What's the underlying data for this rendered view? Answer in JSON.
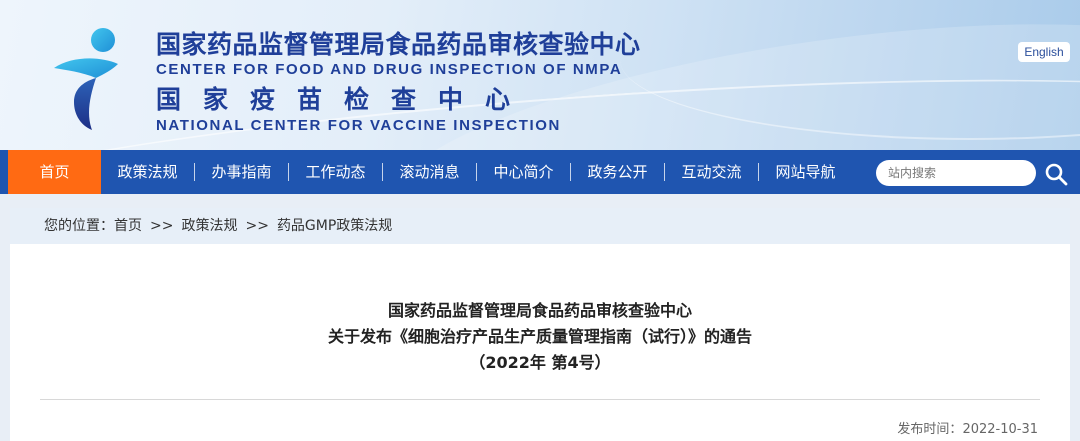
{
  "header": {
    "name_cn": "国家药品监督管理局食品药品审核查验中心",
    "name_en": "CENTER FOR FOOD AND DRUG INSPECTION OF NMPA",
    "name2_cn": "国家疫苗检查中心",
    "name2_en": "NATIONAL CENTER FOR VACCINE INSPECTION",
    "lang_button": "English"
  },
  "nav": {
    "items": [
      {
        "label": "首页",
        "active": true
      },
      {
        "label": "政策法规"
      },
      {
        "label": "办事指南"
      },
      {
        "label": "工作动态"
      },
      {
        "label": "滚动消息"
      },
      {
        "label": "中心简介"
      },
      {
        "label": "政务公开"
      },
      {
        "label": "互动交流"
      },
      {
        "label": "网站导航"
      }
    ],
    "search_placeholder": "站内搜索"
  },
  "breadcrumb": {
    "prefix": "您的位置：",
    "items": [
      "首页",
      "政策法规",
      "药品GMP政策法规"
    ],
    "separator": ">>"
  },
  "article": {
    "title_line1": "国家药品监督管理局食品药品审核查验中心",
    "title_line2": "关于发布《细胞治疗产品生产质量管理指南（试行）》的通告",
    "title_line3": "（2022年 第4号）",
    "date_label": "发布时间：",
    "date": "2022-10-31"
  },
  "colors": {
    "nav_bg": "#1f55b0",
    "nav_active": "#ff6a13",
    "brand_text": "#1f3f99",
    "logo_cyan": "#2fb7e8",
    "logo_navy": "#223a8f"
  }
}
